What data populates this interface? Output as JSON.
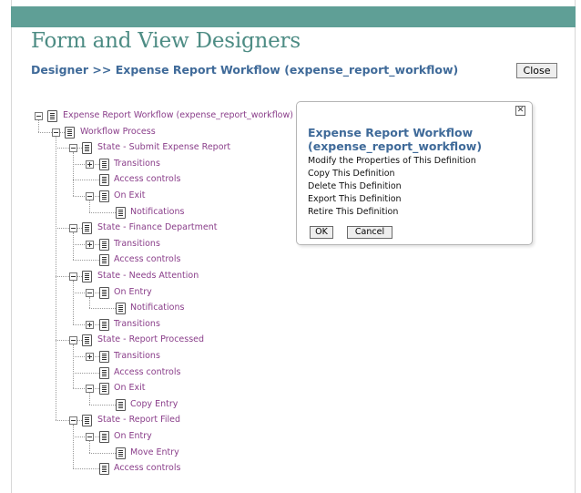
{
  "header": {
    "title": "Form and View Designers",
    "breadcrumb": "Designer >> Expense Report Workflow (expense_report_workflow)",
    "close_label": "Close"
  },
  "tree": [
    "Expense Report Workflow (expense_report_workflow)",
    "Workflow Process",
    "State - Submit Expense Report",
    "Transitions",
    "Access controls",
    "On Exit",
    "Notifications",
    "State - Finance Department",
    "Transitions",
    "Access controls",
    "State - Needs Attention",
    "On Entry",
    "Notifications",
    "Transitions",
    "State - Report Processed",
    "Transitions",
    "Access controls",
    "On Exit",
    "Copy Entry",
    "State - Report Filed",
    "On Entry",
    "Move Entry",
    "Access controls"
  ],
  "popup": {
    "close_glyph": "✕",
    "title": "Expense Report Workflow (expense_report_workflow)",
    "items": [
      "Modify the Properties of This Definition",
      "Copy This Definition",
      "Delete This Definition",
      "Export This Definition",
      "Retire This Definition"
    ],
    "ok_label": "OK",
    "cancel_label": "Cancel"
  },
  "colors": {
    "topbar": "#5f9f96",
    "title": "#4d8c84",
    "breadcrumb": "#3f6a99",
    "tree_link": "#8a3e8a"
  }
}
